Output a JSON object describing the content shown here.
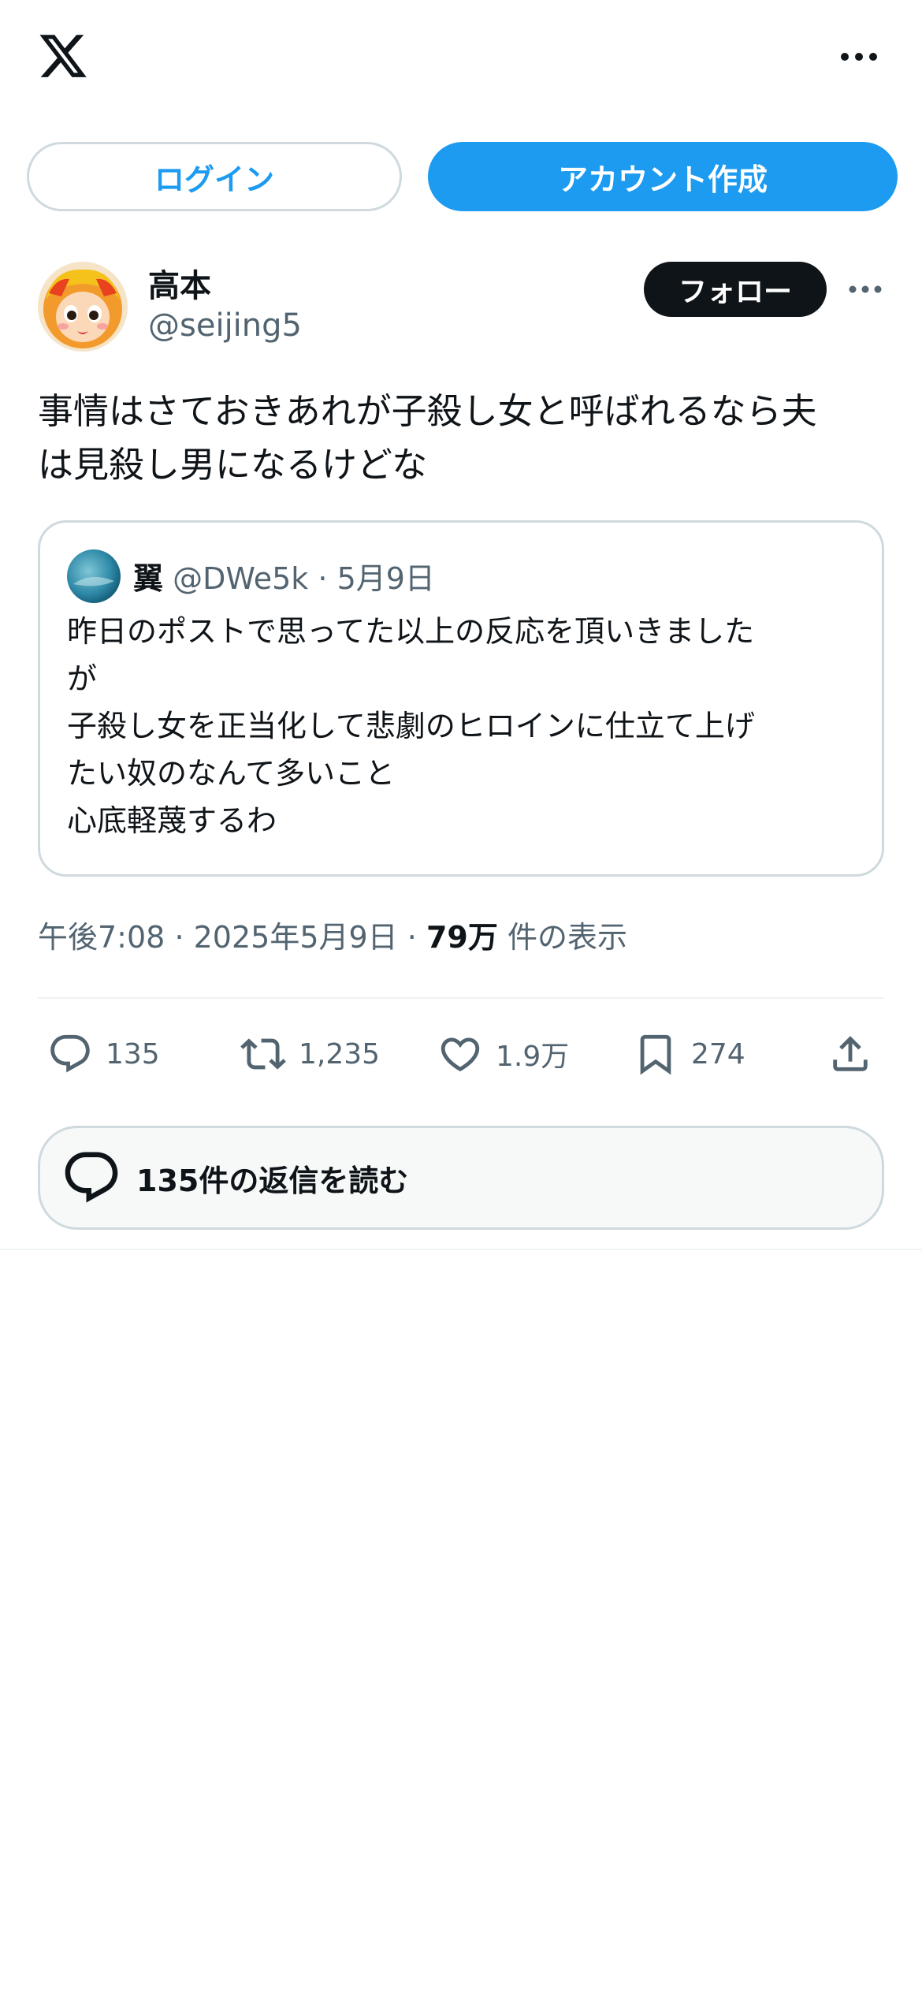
{
  "header": {
    "logo_icon": "x-logo-icon",
    "more_icon": "more-horizontal-icon"
  },
  "auth": {
    "login_label": "ログイン",
    "signup_label": "アカウント作成"
  },
  "post": {
    "author_name": "高本",
    "author_handle": "@seijing5",
    "follow_label": "フォロー",
    "text": "事情はさておきあれが子殺し女と呼ばれるなら夫\nは見殺し男になるけどな",
    "quote": {
      "author_name": "翼",
      "author_handle": "@DWe5k",
      "date": "5月9日",
      "text": "昨日のポストで思ってた以上の反応を頂いきました\nが\n子殺し女を正当化して悲劇のヒロインに仕立て上げ\nたい奴のなんて多いこと\n心底軽蔑するわ"
    },
    "time": "午後7:08",
    "date": "2025年5月9日",
    "views_count": "79万",
    "views_label": "件の表示",
    "separator": "·",
    "actions": {
      "reply_count": "135",
      "repost_count": "1,235",
      "like_count": "1.9万",
      "bookmark_count": "274"
    },
    "read_replies_label": "135件の返信を読む"
  },
  "colors": {
    "accent": "#1d9bf0",
    "text_primary": "#0f1419",
    "text_secondary": "#536471",
    "border": "#cfd9de"
  }
}
